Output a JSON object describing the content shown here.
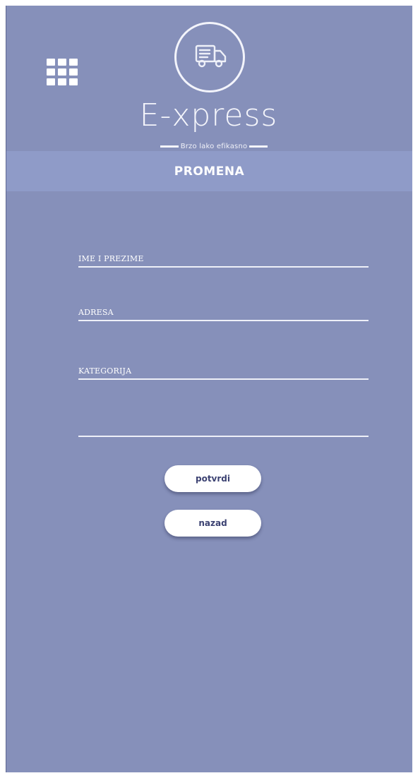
{
  "header": {
    "menu_icon": "grid-menu-icon",
    "logo_icon": "delivery-truck-icon",
    "brand_name": "E-xpress",
    "tagline": "Brzo lako efikasno"
  },
  "page": {
    "title": "PROMENA"
  },
  "form": {
    "fields": [
      {
        "label": "IME I PREZIME",
        "value": ""
      },
      {
        "label": "ADRESA",
        "value": ""
      },
      {
        "label": "KATEGORIJA",
        "value": ""
      },
      {
        "label": "",
        "value": ""
      }
    ],
    "confirm_label": "potvrdi",
    "back_label": "nazad"
  },
  "colors": {
    "background": "#8690ba",
    "title_band": "#8f9bc8",
    "button_text": "#3c4272"
  }
}
